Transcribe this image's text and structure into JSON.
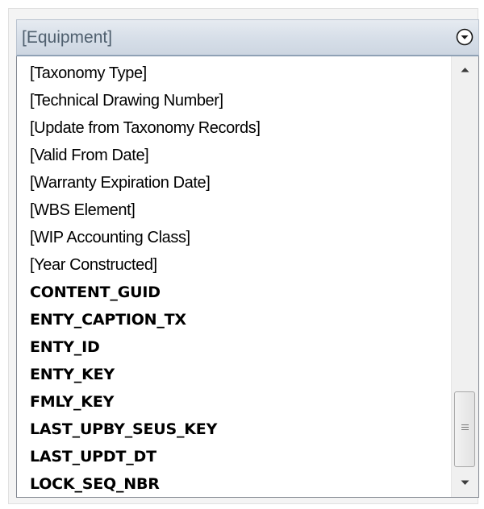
{
  "header": {
    "title": "[Equipment]",
    "dropdown_icon": "chevron-down-circle-icon"
  },
  "list": {
    "items": [
      {
        "label": "[Taxonomy Type]",
        "kind": "field"
      },
      {
        "label": "[Technical Drawing Number]",
        "kind": "field"
      },
      {
        "label": "[Update from Taxonomy Records]",
        "kind": "field"
      },
      {
        "label": "[Valid From Date]",
        "kind": "field"
      },
      {
        "label": "[Warranty Expiration Date]",
        "kind": "field"
      },
      {
        "label": "[WBS Element]",
        "kind": "field"
      },
      {
        "label": "[WIP Accounting Class]",
        "kind": "field"
      },
      {
        "label": "[Year Constructed]",
        "kind": "field"
      },
      {
        "label": "CONTENT_GUID",
        "kind": "column"
      },
      {
        "label": "ENTY_CAPTION_TX",
        "kind": "column"
      },
      {
        "label": "ENTY_ID",
        "kind": "column"
      },
      {
        "label": "ENTY_KEY",
        "kind": "column"
      },
      {
        "label": "FMLY_KEY",
        "kind": "column"
      },
      {
        "label": "LAST_UPBY_SEUS_KEY",
        "kind": "column"
      },
      {
        "label": "LAST_UPDT_DT",
        "kind": "column"
      },
      {
        "label": "LOCK_SEQ_NBR",
        "kind": "column"
      }
    ]
  },
  "scrollbar": {
    "up_icon": "scroll-up-arrow-icon",
    "down_icon": "scroll-down-arrow-icon",
    "grip_icon": "scroll-grip-icon",
    "position_fraction": 0.85
  },
  "colors": {
    "header_text": "#50606f",
    "header_border": "#8fa1b5",
    "list_border": "#828790"
  }
}
